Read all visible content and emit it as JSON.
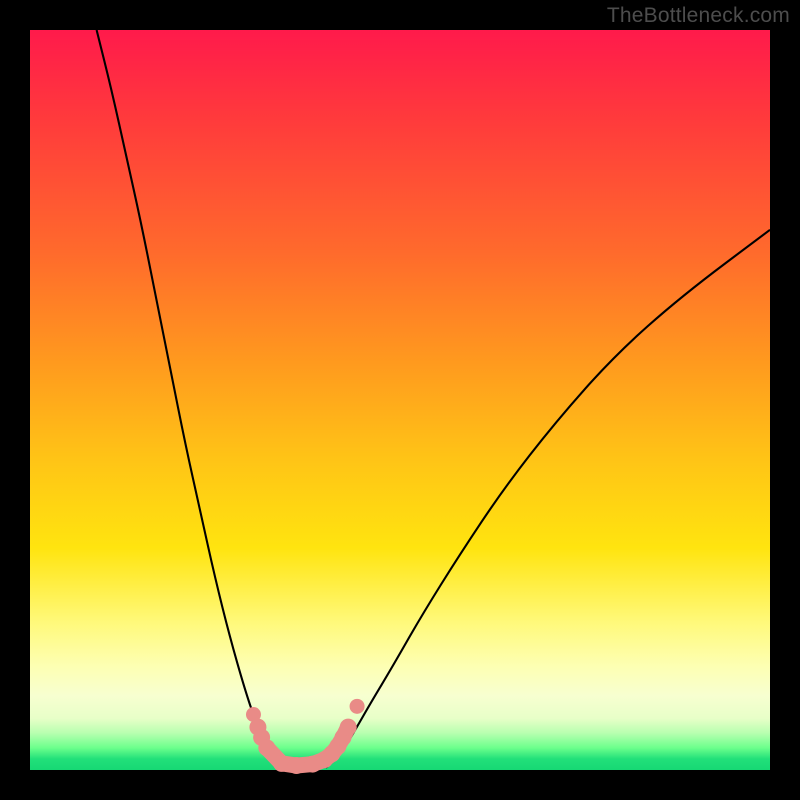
{
  "watermark": "TheBottleneck.com",
  "chart_data": {
    "type": "line",
    "title": "",
    "xlabel": "",
    "ylabel": "",
    "xlim": [
      0,
      100
    ],
    "ylim": [
      0,
      100
    ],
    "grid": false,
    "legend": false,
    "series": [
      {
        "name": "left-branch",
        "comment": "Descending curve from top-left toward valley floor",
        "x": [
          9,
          11,
          13,
          15,
          17,
          19,
          21,
          23,
          25,
          27,
          29,
          30.5,
          32,
          33,
          34,
          34.8
        ],
        "y": [
          100,
          92,
          83,
          74,
          64,
          54,
          44,
          35,
          26,
          18,
          11,
          6.5,
          3.5,
          1.8,
          0.8,
          0.3
        ]
      },
      {
        "name": "right-branch",
        "comment": "Ascending curve from valley floor toward upper right",
        "x": [
          40,
          41,
          42.5,
          44,
          46,
          49,
          53,
          58,
          64,
          71,
          79,
          88,
          100
        ],
        "y": [
          0.3,
          1.2,
          3,
          5.5,
          9,
          14,
          21,
          29,
          38,
          47,
          56,
          64,
          73
        ]
      },
      {
        "name": "markers",
        "comment": "Salmon capsule markers near valley bottom",
        "points": [
          {
            "x": 30.2,
            "y": 7.5
          },
          {
            "x": 30.8,
            "y": 5.8
          },
          {
            "x": 31.3,
            "y": 4.4
          },
          {
            "x": 32.0,
            "y": 3.0
          },
          {
            "x": 34.0,
            "y": 0.9
          },
          {
            "x": 36.0,
            "y": 0.6
          },
          {
            "x": 38.2,
            "y": 0.8
          },
          {
            "x": 39.8,
            "y": 1.4
          },
          {
            "x": 40.8,
            "y": 2.2
          },
          {
            "x": 41.6,
            "y": 3.2
          },
          {
            "x": 42.3,
            "y": 4.4
          },
          {
            "x": 43.0,
            "y": 5.8
          },
          {
            "x": 44.2,
            "y": 8.6
          }
        ]
      }
    ],
    "colors": {
      "curve": "#000000",
      "marker_fill": "#e98b87",
      "gradient_top": "#ff1a4b",
      "gradient_mid": "#ffe40f",
      "gradient_bottom": "#17d874"
    }
  }
}
